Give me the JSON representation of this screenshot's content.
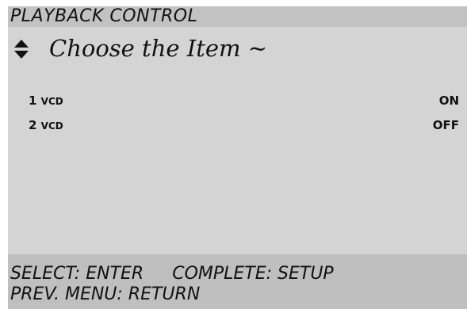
{
  "header": {
    "title": "PLAYBACK CONTROL"
  },
  "subheader": {
    "icon": "up-down-arrows-icon",
    "prompt": "Choose the Item ~"
  },
  "items": [
    {
      "index": "1",
      "label": "VCD",
      "value": "ON"
    },
    {
      "index": "2",
      "label": "VCD",
      "value": "OFF"
    }
  ],
  "footer": {
    "select_hint": "SELECT: ENTER",
    "complete_hint": "COMPLETE: SETUP",
    "prev_menu_hint": "PREV. MENU: RETURN"
  },
  "colors": {
    "screen_background": "#d4d4d4",
    "title_bar": "#c2c2c2",
    "footer_bar": "#bfbfbf",
    "text": "#111111"
  }
}
